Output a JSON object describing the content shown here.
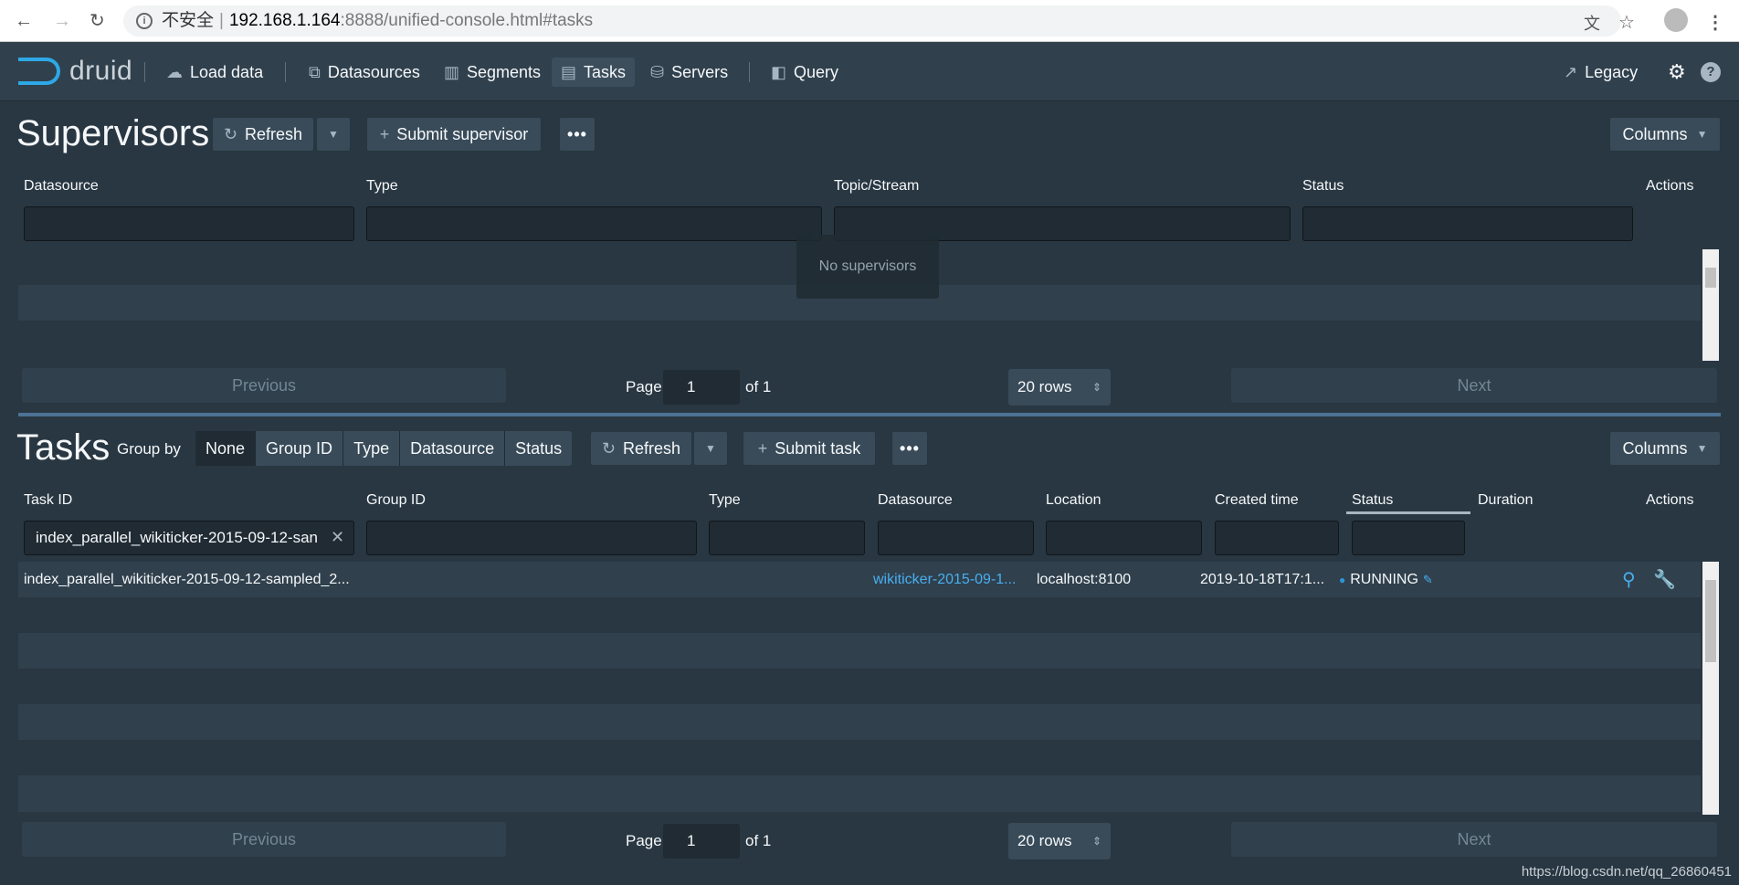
{
  "browser": {
    "insecure_label": "不安全",
    "url_host": "192.168.1.164",
    "url_rest": ":8888/unified-console.html#tasks"
  },
  "topnav": {
    "brand": "druid",
    "items": [
      "Load data",
      "Datasources",
      "Segments",
      "Tasks",
      "Servers",
      "Query"
    ],
    "active": "Tasks",
    "legacy_label": "Legacy"
  },
  "supervisors": {
    "title": "Supervisors",
    "refresh_label": "Refresh",
    "submit_label": "Submit supervisor",
    "columns_label": "Columns",
    "headers": [
      "Datasource",
      "Type",
      "Topic/Stream",
      "Status",
      "Actions"
    ],
    "empty_text": "No supervisors",
    "pager": {
      "previous": "Previous",
      "page_label": "Page",
      "page": "1",
      "of": "of 1",
      "rows": "20 rows",
      "next": "Next"
    }
  },
  "tasks": {
    "title": "Tasks",
    "group_by_label": "Group by",
    "group_options": [
      "None",
      "Group ID",
      "Type",
      "Datasource",
      "Status"
    ],
    "group_selected": "None",
    "refresh_label": "Refresh",
    "submit_label": "Submit task",
    "columns_label": "Columns",
    "headers": [
      "Task ID",
      "Group ID",
      "Type",
      "Datasource",
      "Location",
      "Created time",
      "Status",
      "Duration",
      "Actions"
    ],
    "task_id_filter": "index_parallel_wikiticker-2015-09-12-san",
    "rows": [
      {
        "task_id": "index_parallel_wikiticker-2015-09-12-sampled_2...",
        "group_id": "",
        "type": "",
        "datasource": "wikiticker-2015-09-1...",
        "location": "localhost:8100",
        "created_time": "2019-10-18T17:1...",
        "status": "RUNNING",
        "duration": ""
      }
    ],
    "pager": {
      "previous": "Previous",
      "page_label": "Page",
      "page": "1",
      "of": "of 1",
      "rows": "20 rows",
      "next": "Next"
    }
  },
  "watermark": "https://blog.csdn.net/qq_26860451",
  "colors": {
    "accent": "#48aff0",
    "bg": "#293742",
    "nav": "#30404d",
    "status_running": "#2b95d6"
  }
}
